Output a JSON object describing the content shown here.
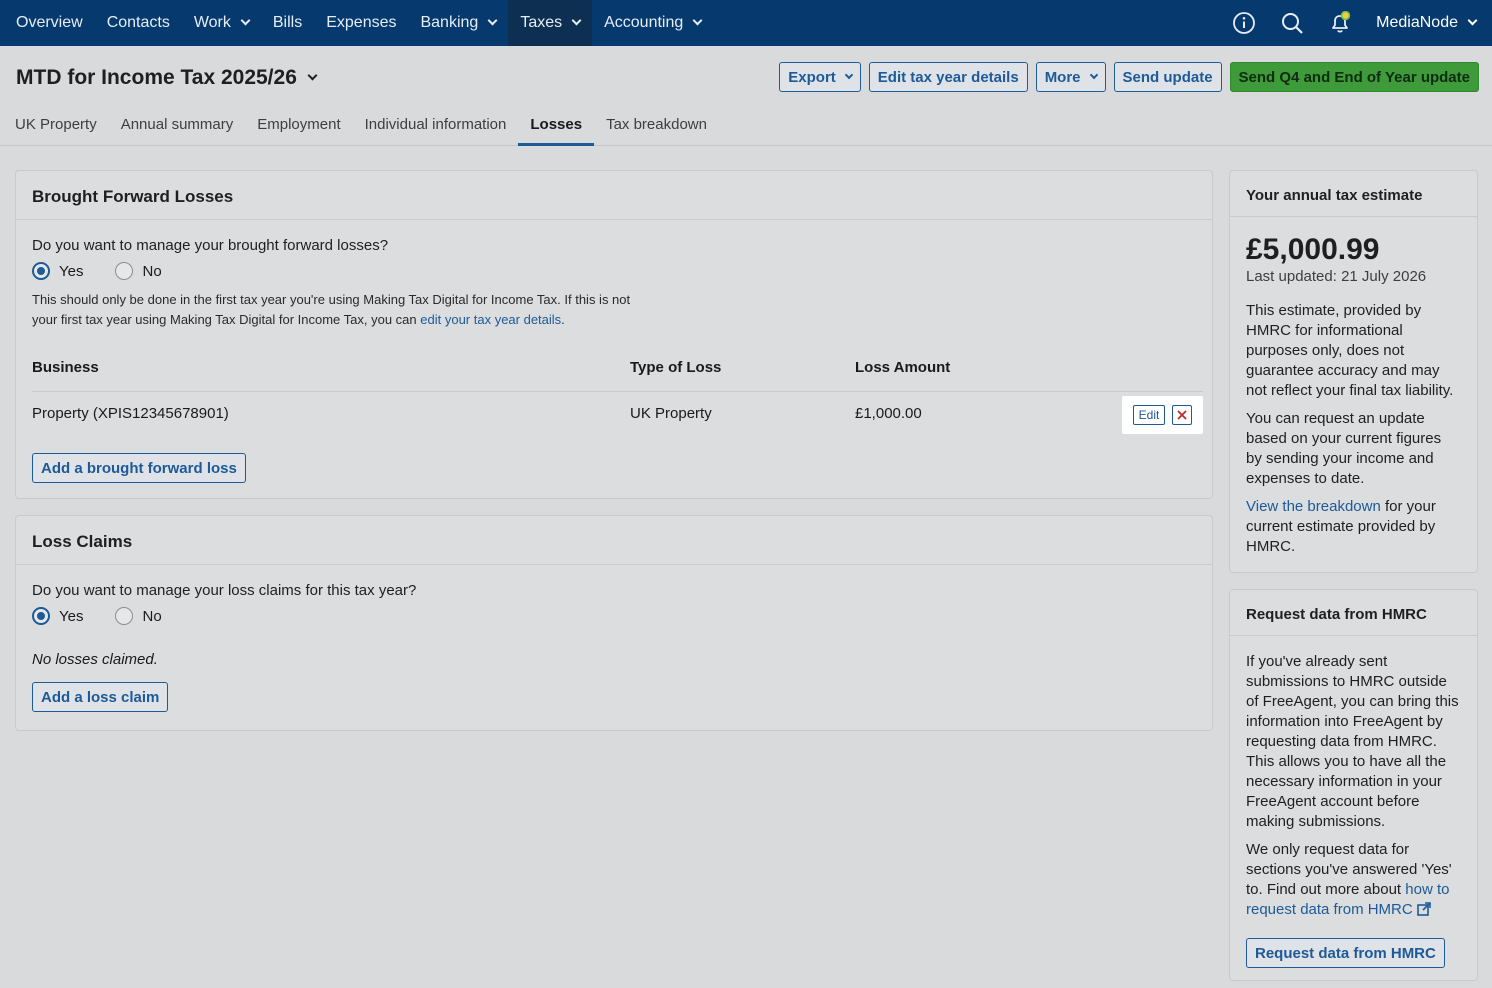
{
  "nav": {
    "items": [
      {
        "label": "Overview",
        "chevron": false
      },
      {
        "label": "Contacts",
        "chevron": false
      },
      {
        "label": "Work",
        "chevron": true
      },
      {
        "label": "Bills",
        "chevron": false
      },
      {
        "label": "Expenses",
        "chevron": false
      },
      {
        "label": "Banking",
        "chevron": true
      },
      {
        "label": "Taxes",
        "chevron": true,
        "active": true
      },
      {
        "label": "Accounting",
        "chevron": true
      }
    ],
    "company": "MediaNode",
    "icons": [
      "info-icon",
      "search-icon",
      "bell-icon"
    ]
  },
  "header": {
    "title": "MTD for Income Tax 2025/26",
    "actions": {
      "export": "Export",
      "edit_tax_year": "Edit tax year details",
      "more": "More",
      "send_update": "Send update",
      "send_q4": "Send Q4 and End of Year update"
    },
    "tabs": [
      {
        "label": "UK Property"
      },
      {
        "label": "Annual summary"
      },
      {
        "label": "Employment"
      },
      {
        "label": "Individual information"
      },
      {
        "label": "Losses",
        "active": true
      },
      {
        "label": "Tax breakdown"
      }
    ]
  },
  "brought_forward": {
    "title": "Brought Forward Losses",
    "question": "Do you want to manage your brought forward losses?",
    "yes": "Yes",
    "no": "No",
    "selected": "Yes",
    "help_1": "This should only be done in the first tax year you're using Making Tax Digital for Income Tax. If this is not your first tax year using Making Tax Digital for Income Tax, you can",
    "help_link": "edit your tax year details",
    "help_end": ".",
    "columns": {
      "business": "Business",
      "type": "Type of Loss",
      "amount": "Loss Amount"
    },
    "row": {
      "business": "Property (XPIS12345678901)",
      "type": "UK Property",
      "amount": "£1,000.00"
    },
    "edit_label": "Edit",
    "add_label": "Add a brought forward loss"
  },
  "loss_claims": {
    "title": "Loss Claims",
    "question": "Do you want to manage your loss claims for this tax year?",
    "yes": "Yes",
    "no": "No",
    "selected": "Yes",
    "empty": "No losses claimed.",
    "add_label": "Add a loss claim"
  },
  "estimate": {
    "title": "Your annual tax estimate",
    "amount": "£5,000.99",
    "updated": "Last updated: 21 July 2026",
    "p1": "This estimate, provided by HMRC for informational purposes only, does not guarantee accuracy and may not reflect your final tax liability.",
    "p2": "You can request an update based on your current figures by sending your income and expenses to date.",
    "p3_link": "View the breakdown",
    "p3_rest": " for your current estimate provided by HMRC."
  },
  "request": {
    "title": "Request data from HMRC",
    "p1": "If you've already sent submissions to HMRC outside of FreeAgent, you can bring this information into FreeAgent by requesting data from HMRC. This allows you to have all the necessary information in your FreeAgent account before making submissions.",
    "p2": "We only request data for sections you've answered 'Yes' to. Find out more about ",
    "p2_link": "how to request data from HMRC",
    "button": "Request data from HMRC"
  },
  "colors": {
    "nav_bg": "#063a6e",
    "accent": "#1d5a97",
    "primary_green": "#3f9a3a",
    "danger": "#c62828"
  }
}
